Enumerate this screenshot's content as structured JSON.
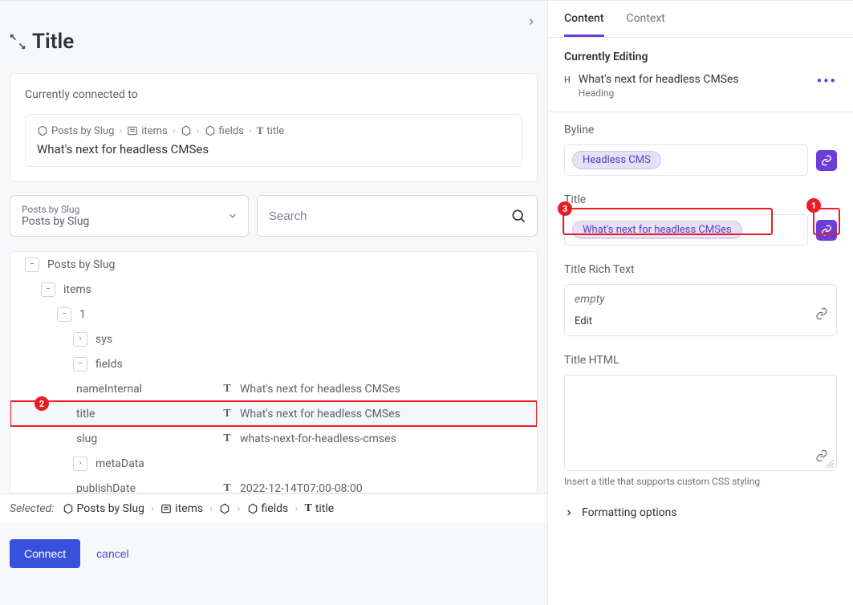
{
  "left": {
    "page_title": "Title",
    "connected_label": "Currently connected to",
    "breadcrumb": [
      "Posts by Slug",
      "items",
      "",
      "fields",
      "title"
    ],
    "breadcrumb_value": "What's next for headless CMSes",
    "dropdown": {
      "label": "Posts by Slug",
      "value": "Posts by Slug"
    },
    "search_placeholder": "Search",
    "tree": [
      {
        "indent": 0,
        "expander": "−",
        "label": "Posts by Slug"
      },
      {
        "indent": 1,
        "expander": "−",
        "label": "items"
      },
      {
        "indent": 2,
        "expander": "−",
        "label": "1"
      },
      {
        "indent": 3,
        "expander": "›",
        "label": "sys"
      },
      {
        "indent": 3,
        "expander": "−",
        "label": "fields"
      },
      {
        "indent": 4,
        "leaf": true,
        "label": "nameInternal",
        "type": "T",
        "value": "What's next for headless CMSes"
      },
      {
        "indent": 4,
        "leaf": true,
        "label": "title",
        "type": "T",
        "value": "What's next for headless CMSes",
        "selected": true
      },
      {
        "indent": 4,
        "leaf": true,
        "label": "slug",
        "type": "T",
        "value": "whats-next-for-headless-cmses"
      },
      {
        "indent": 3,
        "expander": "›",
        "label": "metaData"
      },
      {
        "indent": 4,
        "leaf": true,
        "label": "publishDate",
        "type": "T",
        "value": "2022-12-14T07:00-08:00"
      }
    ],
    "footer": {
      "selected_label": "Selected:",
      "path": [
        "Posts by Slug",
        "items",
        "",
        "fields",
        "title"
      ]
    },
    "actions": {
      "connect": "Connect",
      "cancel": "cancel"
    },
    "callout_2": "2"
  },
  "right": {
    "tabs": {
      "content": "Content",
      "context": "Context"
    },
    "editing": {
      "heading": "Currently Editing",
      "badge": "H",
      "name": "What's next for headless CMSes",
      "type": "Heading"
    },
    "byline": {
      "label": "Byline",
      "pill": "Headless CMS"
    },
    "title_field": {
      "label": "Title",
      "pill": "What's next for headless CMSes"
    },
    "title_rt": {
      "label": "Title Rich Text",
      "empty": "empty",
      "edit": "Edit"
    },
    "title_html": {
      "label": "Title HTML",
      "help": "Insert a title that supports custom CSS styling"
    },
    "formatting": "Formatting options",
    "callout_1": "1",
    "callout_3": "3"
  }
}
